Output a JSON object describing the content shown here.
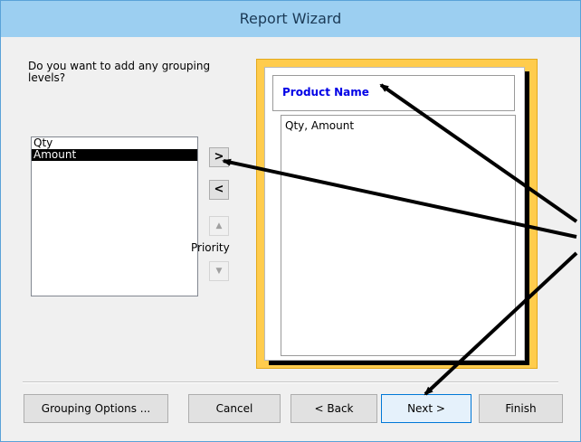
{
  "window": {
    "title": "Report Wizard"
  },
  "question": "Do you want to add any grouping levels?",
  "fields_list": {
    "items": [
      "Qty",
      "Amount"
    ],
    "selected_index": 1
  },
  "move_buttons": {
    "add": ">",
    "remove": "<",
    "up": "▲",
    "down": "▼"
  },
  "priority_label": "Priority",
  "preview": {
    "group_label": "Product Name",
    "detail_label": "Qty, Amount",
    "frame_color": "#ffcc4d",
    "group_text_color": "#0000e6"
  },
  "buttons": {
    "grouping_options": "Grouping Options ...",
    "cancel": "Cancel",
    "back": "< Back",
    "next": "Next >",
    "finish": "Finish"
  }
}
